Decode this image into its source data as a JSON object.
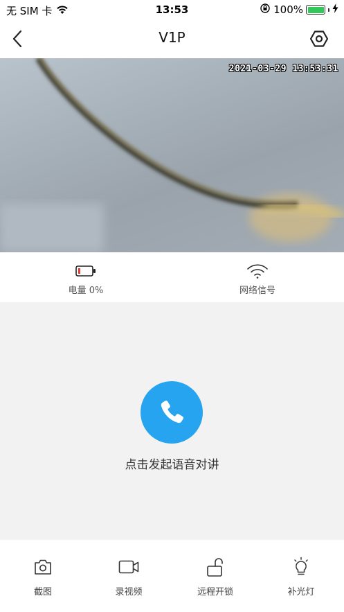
{
  "status_bar": {
    "carrier": "无 SIM 卡",
    "time": "13:53",
    "battery_percent": "100%",
    "battery_level": 1.0,
    "icons": [
      "wifi-icon",
      "orientation-lock-icon",
      "battery-icon",
      "charging-icon"
    ]
  },
  "nav": {
    "title": "V1P",
    "back_icon": "chevron-left-icon",
    "settings_icon": "hexagon-settings-icon"
  },
  "video": {
    "timestamp": "2021-03-29 13:53:31"
  },
  "device_status": {
    "battery_label": "电量 0%",
    "battery_level": 0.0,
    "network_label": "网络信号"
  },
  "talk": {
    "hint": "点击发起语音对讲",
    "button_color": "#26a4f0"
  },
  "toolbar": {
    "items": [
      {
        "label": "截图",
        "icon": "camera-icon"
      },
      {
        "label": "录视频",
        "icon": "video-camera-icon"
      },
      {
        "label": "远程开锁",
        "icon": "unlock-icon"
      },
      {
        "label": "补光灯",
        "icon": "light-bulb-icon"
      }
    ]
  },
  "colors": {
    "accent": "#26a4f0",
    "battery_low": "#e53935",
    "battery_full": "#34c759",
    "talk_bg": "#f2f2f2"
  }
}
